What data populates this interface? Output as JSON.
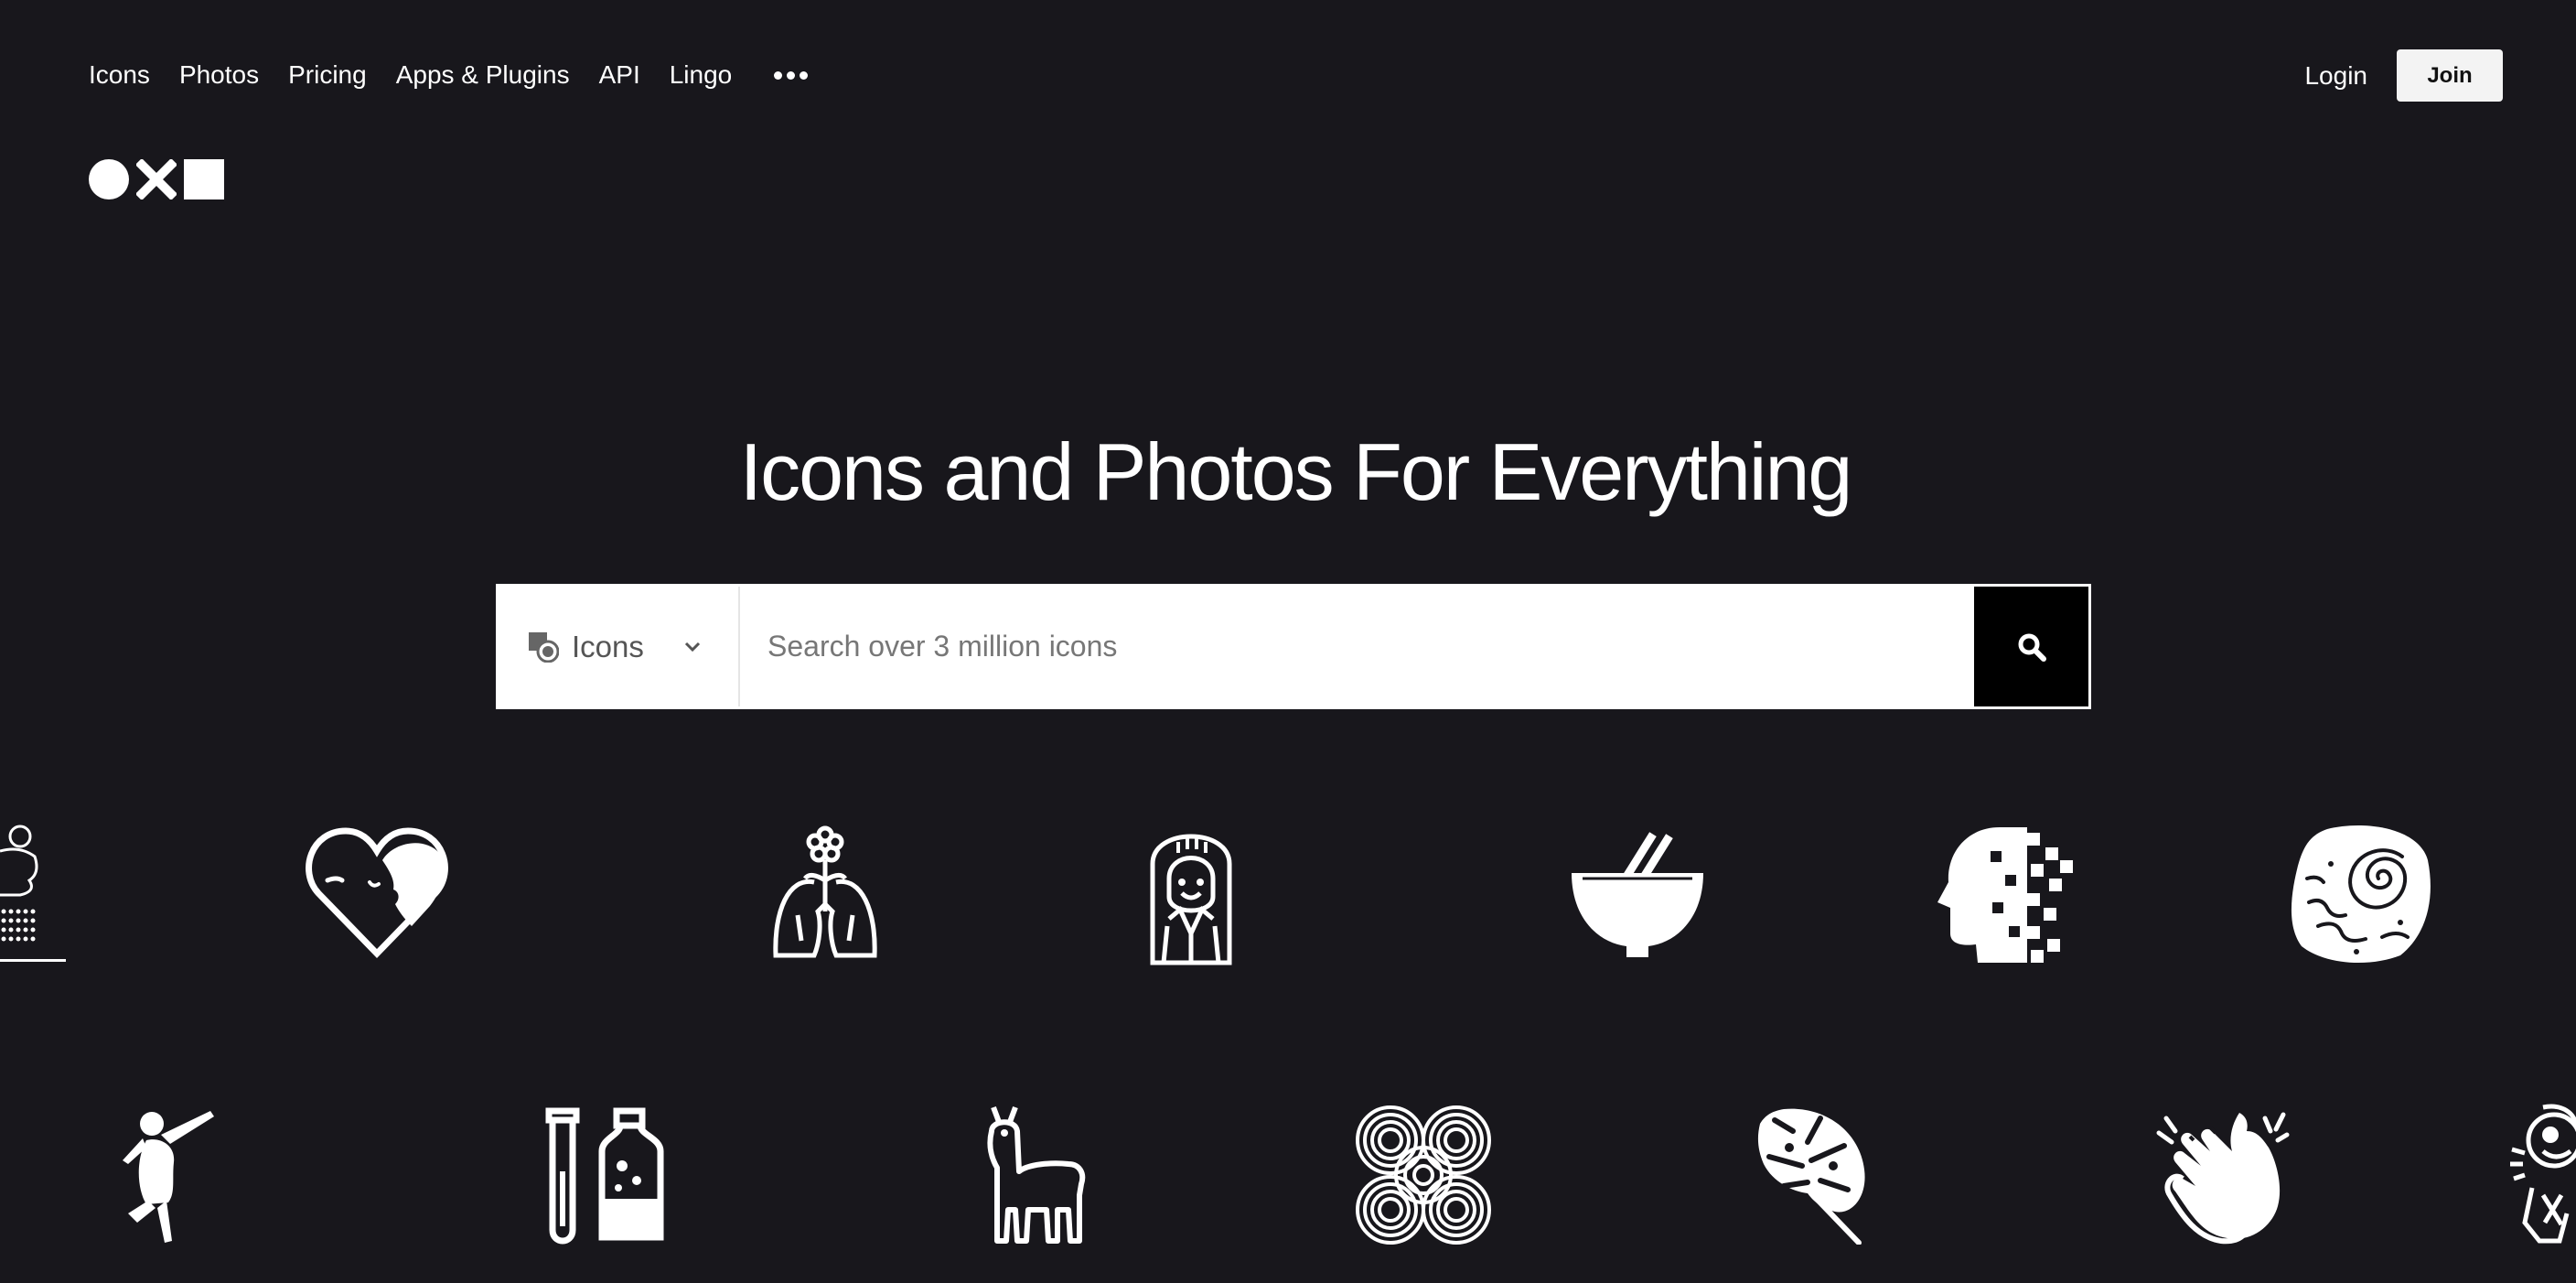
{
  "nav": {
    "links": [
      "Icons",
      "Photos",
      "Pricing",
      "Apps & Plugins",
      "API",
      "Lingo"
    ],
    "more": "more-options",
    "login": "Login",
    "join": "Join"
  },
  "hero": {
    "title": "Icons and Photos For Everything"
  },
  "search": {
    "type_label": "Icons",
    "placeholder": "Search over 3 million icons"
  },
  "icon_rows": {
    "row1": [
      "meditating-figure-icon",
      "heart-face-icon",
      "lungs-flower-icon",
      "woman-portrait-icon",
      "bowl-chopsticks-icon",
      "pixel-head-icon",
      "fossil-stone-icon"
    ],
    "row2": [
      "dancer-icon",
      "test-tube-bottle-icon",
      "llama-icon",
      "spiral-pattern-icon",
      "monstera-leaf-icon",
      "clapping-hands-icon",
      "monkey-icon"
    ]
  },
  "colors": {
    "background": "#18171c",
    "text": "#ffffff",
    "join_bg": "#f3f3f3",
    "search_button": "#000000"
  }
}
